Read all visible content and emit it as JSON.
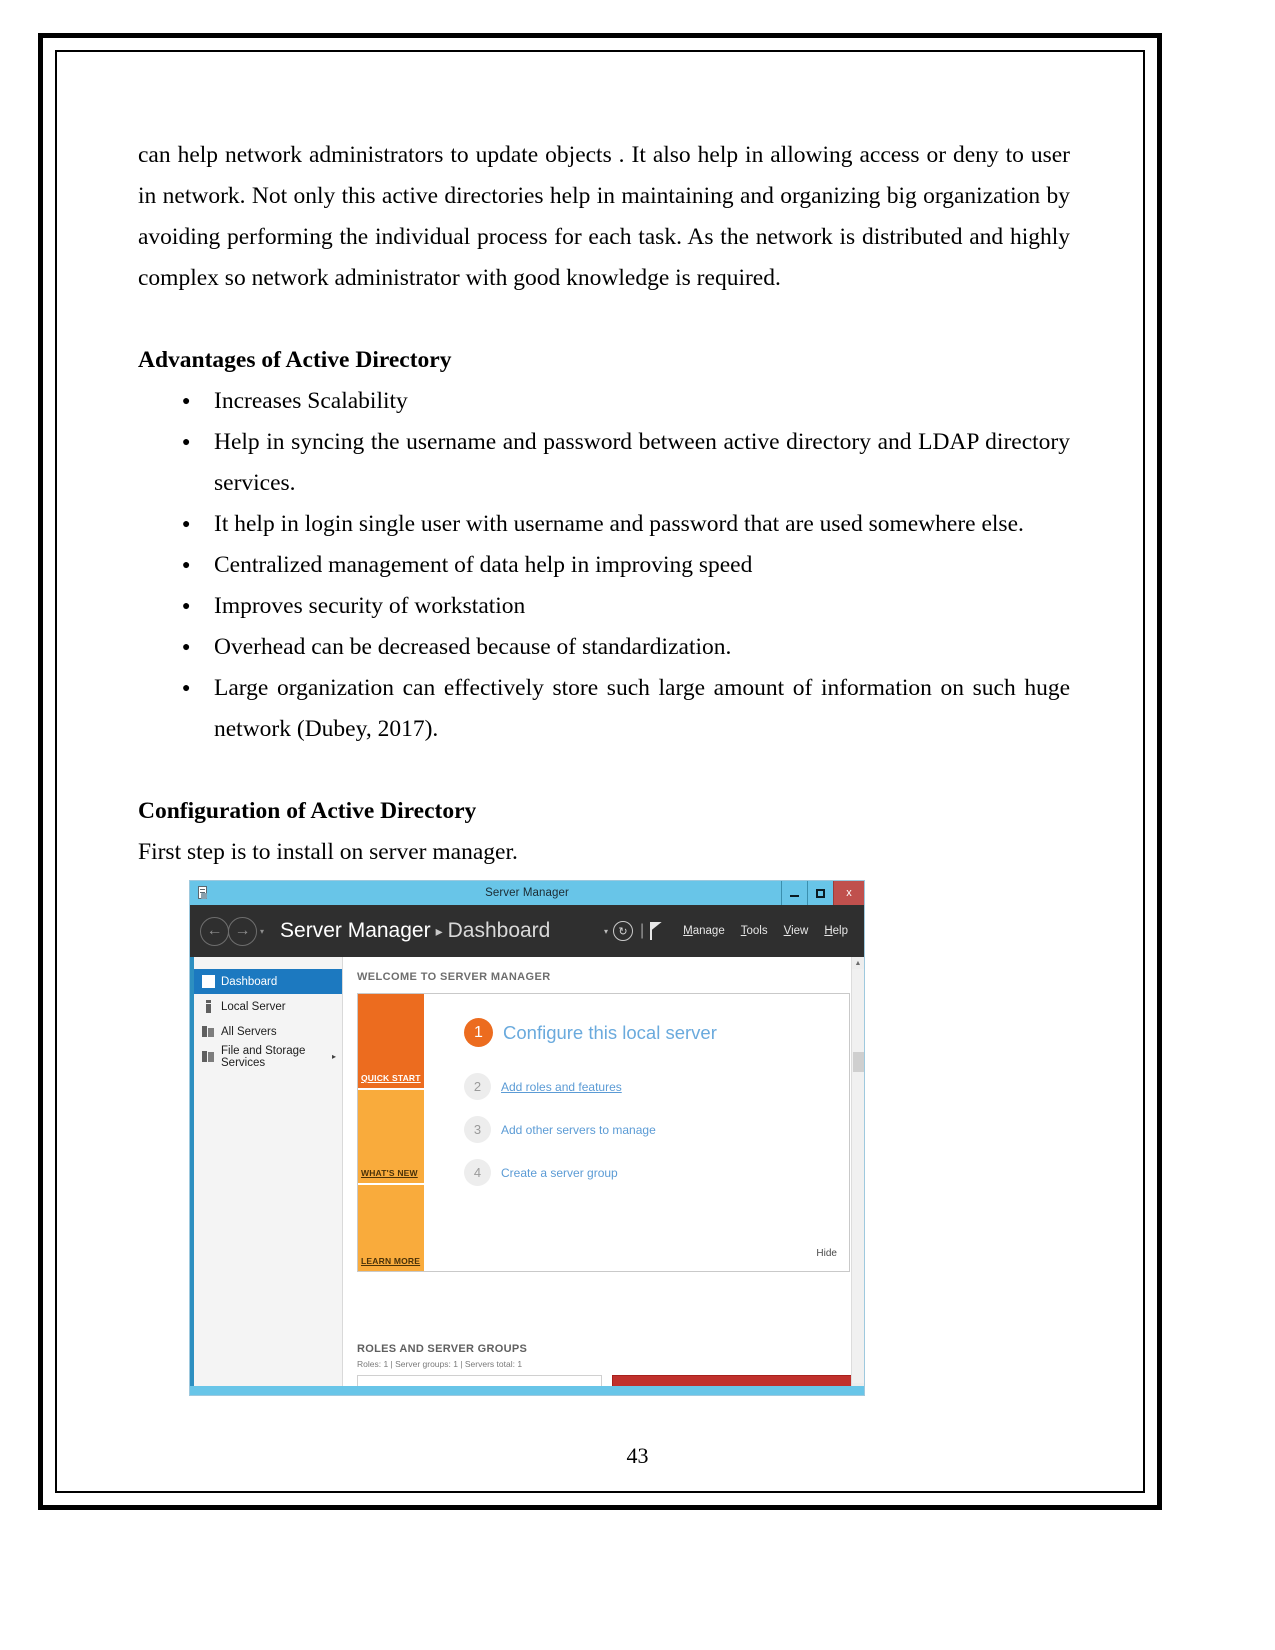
{
  "document": {
    "paragraph_1": "can help network administrators to update objects . It also help in allowing access or deny to user in network. Not only this active directories help  in maintaining and organizing big organization by avoiding performing the individual process for each task. As the network is distributed and highly complex so network administrator with good knowledge is required.",
    "heading_advantages": "Advantages of Active Directory",
    "bullets": [
      "Increases Scalability",
      "Help in syncing the username and password between active directory and LDAP directory services.",
      "It help in login single user with username and password that are used somewhere else.",
      "Centralized management of data help in improving speed",
      "Improves security of workstation",
      "Overhead can be decreased because of standardization.",
      "Large organization can effectively store such large amount of information on such huge network (Dubey, 2017)."
    ],
    "heading_configuration": "Configuration of Active Directory",
    "caption": "First step is to install on server manager.",
    "page_number": "43"
  },
  "server_manager": {
    "titlebar": {
      "icon": "server-manager-icon",
      "title": "Server Manager",
      "minimize": "–",
      "maximize": "▭",
      "close": "x"
    },
    "header": {
      "back_arrow": "←",
      "forward_arrow": "→",
      "dropdown_caret": "▾",
      "breadcrumb_root": "Server Manager",
      "breadcrumb_separator": "▸",
      "breadcrumb_current": "Dashboard",
      "refresh_icon": "↻",
      "notifications_icon": "flag-icon",
      "menus": [
        {
          "label": "Manage",
          "accel": "M"
        },
        {
          "label": "Tools",
          "accel": "T"
        },
        {
          "label": "View",
          "accel": "V"
        },
        {
          "label": "Help",
          "accel": "H"
        }
      ]
    },
    "sidebar": {
      "items": [
        {
          "label": "Dashboard",
          "icon": "dashboard-icon",
          "active": true,
          "expandable": false
        },
        {
          "label": "Local Server",
          "icon": "local-server-icon",
          "active": false,
          "expandable": false
        },
        {
          "label": "All Servers",
          "icon": "all-servers-icon",
          "active": false,
          "expandable": false
        },
        {
          "label": "File and Storage Services",
          "icon": "file-storage-icon",
          "active": false,
          "expandable": true,
          "chevron": "▸"
        }
      ]
    },
    "main": {
      "welcome_label": "WELCOME TO SERVER MANAGER",
      "tiles": [
        {
          "label": "QUICK START",
          "color": "#ec6c1f"
        },
        {
          "label": "WHAT'S NEW",
          "color": "#f9ab3c"
        },
        {
          "label": "LEARN MORE",
          "color": "#f9ab3c"
        }
      ],
      "steps": [
        {
          "number": "1",
          "label": "Configure this local server"
        },
        {
          "number": "2",
          "label": "Add roles and features"
        },
        {
          "number": "3",
          "label": "Add other servers to manage"
        },
        {
          "number": "4",
          "label": "Create a server group"
        }
      ],
      "hide_label": "Hide",
      "roles_title": "ROLES AND SERVER GROUPS",
      "roles_meta": "Roles: 1  |  Server groups: 1  |  Servers total: 1"
    }
  }
}
